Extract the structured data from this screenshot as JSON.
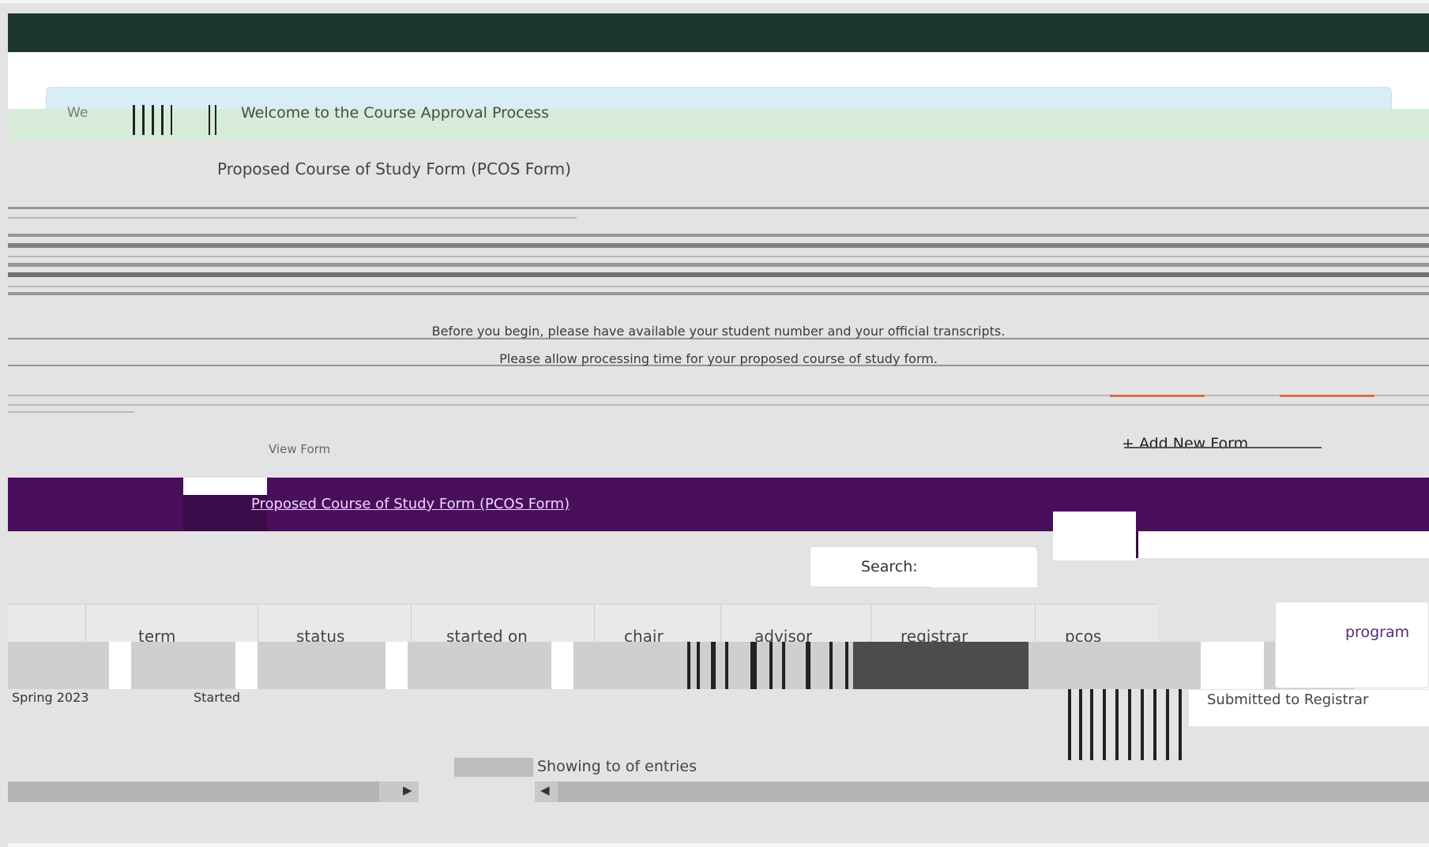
{
  "welcome": {
    "short": "We",
    "message": "Welcome to the Course Approval Process"
  },
  "proposal": {
    "title": "Proposed Course of Study Form (PCOS Form)"
  },
  "body": {
    "line1": "Before you begin, please have available your student number and your official transcripts.",
    "line2": "Please allow processing time for your proposed course of study form."
  },
  "toolbar": {
    "view_label": "View Form",
    "add_new_label": "+ Add New Form"
  },
  "tabs": {
    "active_title": "Proposed Course of Study Form (PCOS Form)"
  },
  "search": {
    "label": "Search:",
    "placeholder": ""
  },
  "table": {
    "columns": [
      "term",
      "status",
      "started on",
      "chair",
      "advisor",
      "registrar",
      "pcos"
    ],
    "row_text_1": "Spring 2023",
    "row_text_2": "Started",
    "program_label": "program",
    "side_text": "Submitted to Registrar"
  },
  "pager": {
    "showing": "Showing  to  of  entries"
  }
}
